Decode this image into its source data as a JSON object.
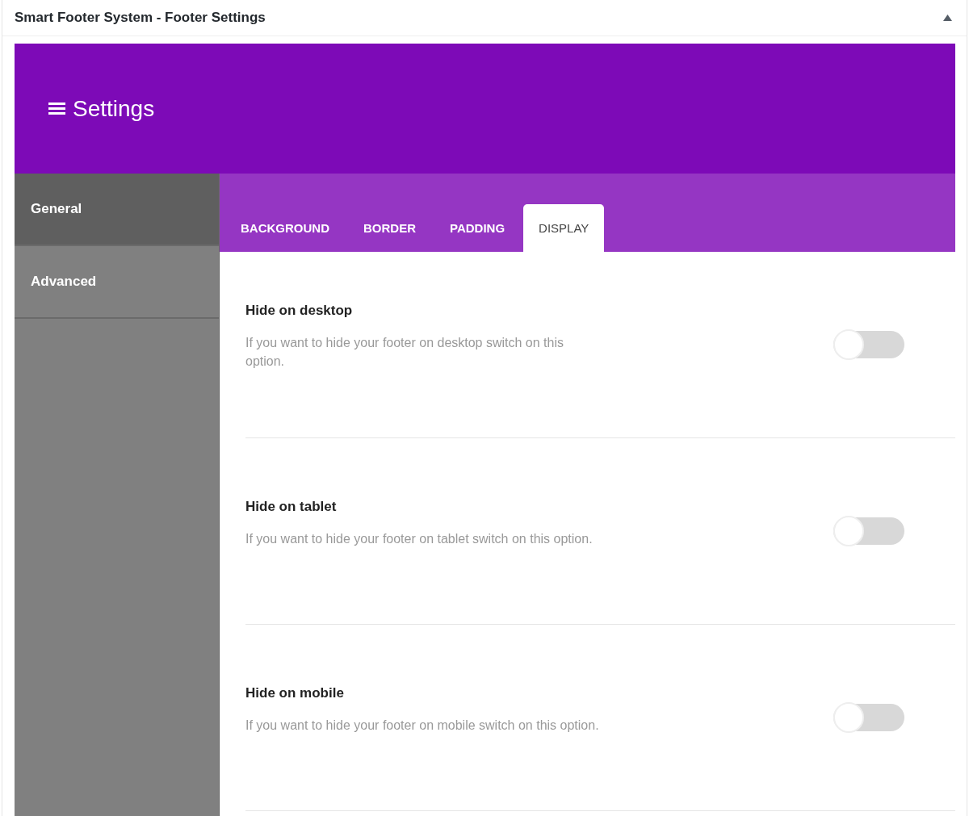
{
  "panel": {
    "title": "Smart Footer System - Footer Settings",
    "expanded": true
  },
  "header": {
    "title": "Settings"
  },
  "sidebar": {
    "items": [
      {
        "label": "General",
        "selected": true
      },
      {
        "label": "Advanced",
        "selected": false
      }
    ]
  },
  "tabs": [
    {
      "label": "BACKGROUND",
      "selected": false
    },
    {
      "label": "BORDER",
      "selected": false
    },
    {
      "label": "PADDING",
      "selected": false
    },
    {
      "label": "DISPLAY",
      "selected": true
    }
  ],
  "settings": [
    {
      "title": "Hide on desktop",
      "description": "If you want to hide your footer on desktop switch on this option.",
      "on": false
    },
    {
      "title": "Hide on tablet",
      "description": "If you want to hide your footer on tablet switch on this option.",
      "on": false
    },
    {
      "title": "Hide on mobile",
      "description": "If you want to hide your footer on mobile switch on this option.",
      "on": false
    }
  ]
}
